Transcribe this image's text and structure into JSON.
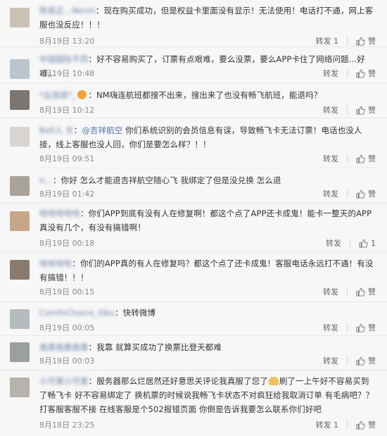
{
  "actions": {
    "repost_label": "转发",
    "like_icon": "thumbs-up-icon"
  },
  "comments": [
    {
      "name": "陈丽正…Nevin",
      "text": "现在购买成功，但是权益卡里面没有显示！无法使用！电话打不通，网上客服也没反应！！！",
      "time": "8月19日 13:20",
      "repost_count": "1",
      "likes": "赞",
      "avatar_color": "#c9c2b4"
    },
    {
      "name": "中国国际不四",
      "text": "好不容易购买了，订票有点艰难，要么没票，要么APP卡住了网络问题…好难…",
      "time": "8月19日 10:48",
      "repost_count": "",
      "likes": "赞",
      "avatar_color": "#b9c6cf"
    },
    {
      "name": "*丛加成*_",
      "text": "NM嗨连航班都搜不出来，搜出来了也没有畅飞航班，能退吗？",
      "time": "8月19日 10:12",
      "repost_count": "",
      "likes": "赞",
      "avatar_color": "#7c7570"
    },
    {
      "name": "Bell人 文",
      "mention": "@吉祥航空",
      "text": "你们系统识别的会员信息有误，导致畅飞卡无法订票！电话也没人接，线上客服也没人回，你们是要怎么样？！！",
      "time": "8月19日 09:51",
      "repost_count": "",
      "likes": "赞",
      "avatar_color": "#d8d4cf"
    },
    {
      "name": "n…",
      "text": "你好 怎么才能退吉祥航空随心飞 我绑定了但是没兑换 怎么退",
      "time": "8月19日 01:42",
      "repost_count": "",
      "likes": "赞",
      "avatar_color": "#a8a29a"
    },
    {
      "name": "哈哈哈哈哈",
      "text": "你们APP到底有没有人在修复啊！都这个点了APP还卡成鬼！能卡一整天的APP真没有几个，有没有搞错啊！",
      "time": "8月19日 00:18",
      "repost_count": "",
      "likes": "1",
      "avatar_color": "#c7a687"
    },
    {
      "name": "哈哈哈哈",
      "text": "你们的APP真的有人在修复吗？都这个点了还卡成鬼！客服电话永远打不通！有没有搞错！！！",
      "time": "8月19日 00:15",
      "repost_count": "",
      "likes": "赞",
      "avatar_color": "#8a7a6c"
    },
    {
      "name": "ComfoChoice_Gbu",
      "text": "快转微博",
      "time": "8月19日 00:05",
      "repost_count": "",
      "likes": "赞",
      "avatar_color": "#b5bcc0"
    },
    {
      "name": "我靠我靠我靠",
      "text": "我靠 就算买成功了换票比登天都难",
      "time": "8月19日 00:03",
      "repost_count": "",
      "likes": "赞",
      "avatar_color": "#9aa09b"
    },
    {
      "name": "小可爱小可爱",
      "text_before": "服务器那么烂居然还好意思关评论我真服了您了",
      "text": "刷了一上午好不容易买到了畅飞卡 好不容易绑定了 换机票的时候说我畅飞卡状态不对疯狂给我取消订单 有毛病吧？？打客服客服不接 在线客服是个502报错页面 你倒是告诉我要怎么联系你们好吧",
      "time": "8月18日 23:25",
      "repost_count": "1",
      "likes": "赞",
      "avatar_color": "#b7b2ab"
    }
  ]
}
